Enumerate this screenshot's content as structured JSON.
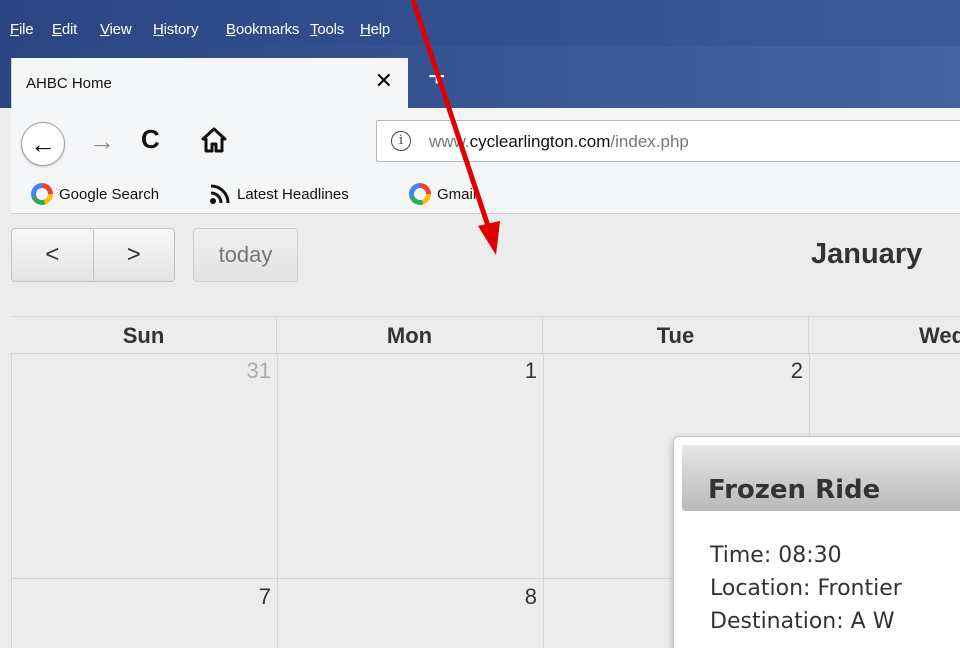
{
  "menubar": {
    "items": [
      "File",
      "Edit",
      "View",
      "History",
      "Bookmarks",
      "Tools",
      "Help"
    ]
  },
  "tab": {
    "title": "AHBC Home",
    "close": "✕",
    "new_tab": "+"
  },
  "nav": {
    "back": "←",
    "forward": "→",
    "reload": "C",
    "url_prefix": "www.",
    "url_host": "cyclearlington.com",
    "url_path": "/index.php"
  },
  "bookmarks": [
    "Google Search",
    "Latest Headlines",
    "Gmail"
  ],
  "calendar": {
    "prev": "<",
    "next": ">",
    "today_label": "today",
    "month_title": "January",
    "weekdays": [
      "Sun",
      "Mon",
      "Tue",
      "Wed"
    ],
    "week1": [
      "31",
      "1",
      "2"
    ],
    "week2": [
      "7",
      "8"
    ]
  },
  "popover": {
    "title": "Frozen Ride",
    "time": "Time: 08:30",
    "location": "Location: Frontier",
    "destination": "Destination: A W"
  },
  "colors": {
    "menubar": "#2b4582",
    "arrow": "#e00000"
  }
}
